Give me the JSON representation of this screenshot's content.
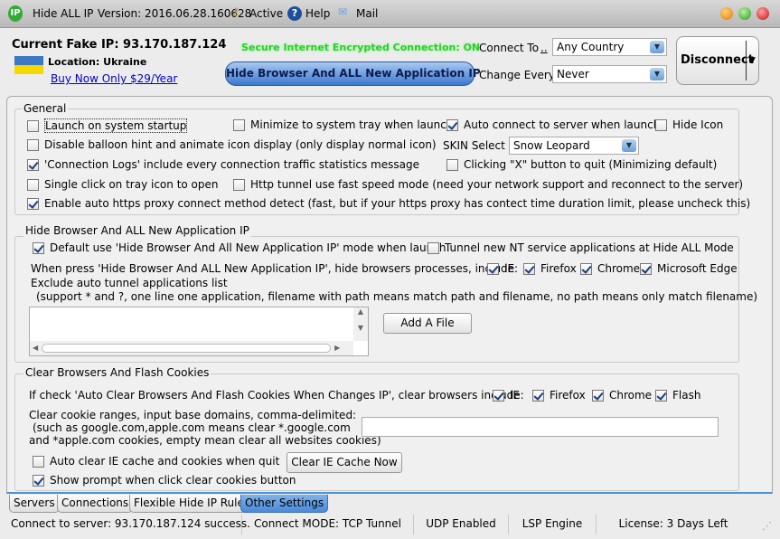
{
  "titlebar": {
    "app_name": "Hide ALL IP",
    "version": "Version: 2016.06.28.160628",
    "active": "Active",
    "help": "Help",
    "mail": "Mail",
    "logo_text": "IP"
  },
  "header": {
    "fake_ip": "Current Fake IP: 93.170.187.124",
    "location": "Location: Ukraine",
    "buy_link": "Buy Now Only $29/Year",
    "secure_status": "Secure Internet Encrypted Connection: ON",
    "hide_button": "Hide Browser And ALL New Application IP",
    "connect_to_label": "Connect To",
    "connect_to_link": "..",
    "connect_to_value": "Any Country",
    "change_every_label": "Change Every",
    "change_every_value": "Never",
    "disconnect": "Disconnect",
    "secure_color": "#2ecc2e"
  },
  "general": {
    "title": "General",
    "items": [
      {
        "label": "Launch on system startup",
        "checked": false
      },
      {
        "label": "Minimize to system tray when launch",
        "checked": false
      },
      {
        "label": "Auto connect to server when launch",
        "checked": true
      },
      {
        "label": "Hide Icon",
        "checked": false
      },
      {
        "label": "Disable balloon hint and animate icon display (only display normal icon)",
        "checked": false
      },
      {
        "label": "'Connection Logs' include every connection traffic statistics message",
        "checked": true
      },
      {
        "label": "Clicking \"X\" button to quit (Minimizing default)",
        "checked": false
      },
      {
        "label": "Single click on tray icon to open",
        "checked": false
      },
      {
        "label": "Http tunnel use fast speed mode (need your network support and reconnect to the server)",
        "checked": false
      },
      {
        "label": "Enable auto https proxy connect method detect (fast,  but if your https proxy has contect time duration limit, please uncheck this)",
        "checked": true
      }
    ],
    "skin_label": "SKIN Select",
    "skin_value": "Snow Leopard"
  },
  "hide_browser": {
    "title": "Hide Browser And ALL New Application IP",
    "default_mode": {
      "label": "Default use 'Hide Browser And All New Application IP' mode when launch",
      "checked": true
    },
    "tunnel_nt": {
      "label": "Tunnel new NT service applications at Hide ALL Mode",
      "checked": false
    },
    "processes_label": "When press 'Hide Browser And ALL New Application IP', hide browsers processes, include:",
    "browsers": [
      {
        "label": "IE",
        "checked": true
      },
      {
        "label": "Firefox",
        "checked": true
      },
      {
        "label": "Chrome",
        "checked": true
      },
      {
        "label": "Microsoft Edge",
        "checked": true
      }
    ],
    "exclude_label": "Exclude auto tunnel applications list",
    "exclude_hint": "(support * and ?, one line one application, filename with path means match path and filename,  no path means only match filename)",
    "exclude_value": "",
    "add_file": "Add A File"
  },
  "cookies": {
    "title": "Clear Browsers And Flash Cookies",
    "browsers_label": "If check 'Auto Clear Browsers And Flash Cookies When Changes IP', clear browsers include:",
    "browsers": [
      {
        "label": "IE",
        "checked": true
      },
      {
        "label": "Firefox",
        "checked": true
      },
      {
        "label": "Chrome",
        "checked": true
      },
      {
        "label": "Flash",
        "checked": true
      }
    ],
    "range_l1": "Clear cookie ranges, input base domains,  comma-delimited:",
    "range_l2": "(such as google.com,apple.com means clear *.google.com",
    "range_l3": "and *apple.com cookies, empty mean clear all websites cookies)",
    "range_value": "",
    "auto_clear": {
      "label": "Auto clear IE cache and cookies when quit",
      "checked": false
    },
    "show_prompt": {
      "label": "Show prompt when click clear cookies button",
      "checked": true
    },
    "clear_now": "Clear IE Cache Now"
  },
  "tabs": [
    {
      "label": "Servers",
      "active": false
    },
    {
      "label": "Connections",
      "active": false
    },
    {
      "label": "Flexible Hide IP Rules",
      "active": false
    },
    {
      "label": "Other Settings",
      "active": true
    }
  ],
  "status": [
    "Connect to server: 93.170.187.124 success.",
    "Connect MODE: TCP Tunnel",
    "UDP Enabled",
    "LSP Engine",
    "License: 3 Days Left"
  ]
}
